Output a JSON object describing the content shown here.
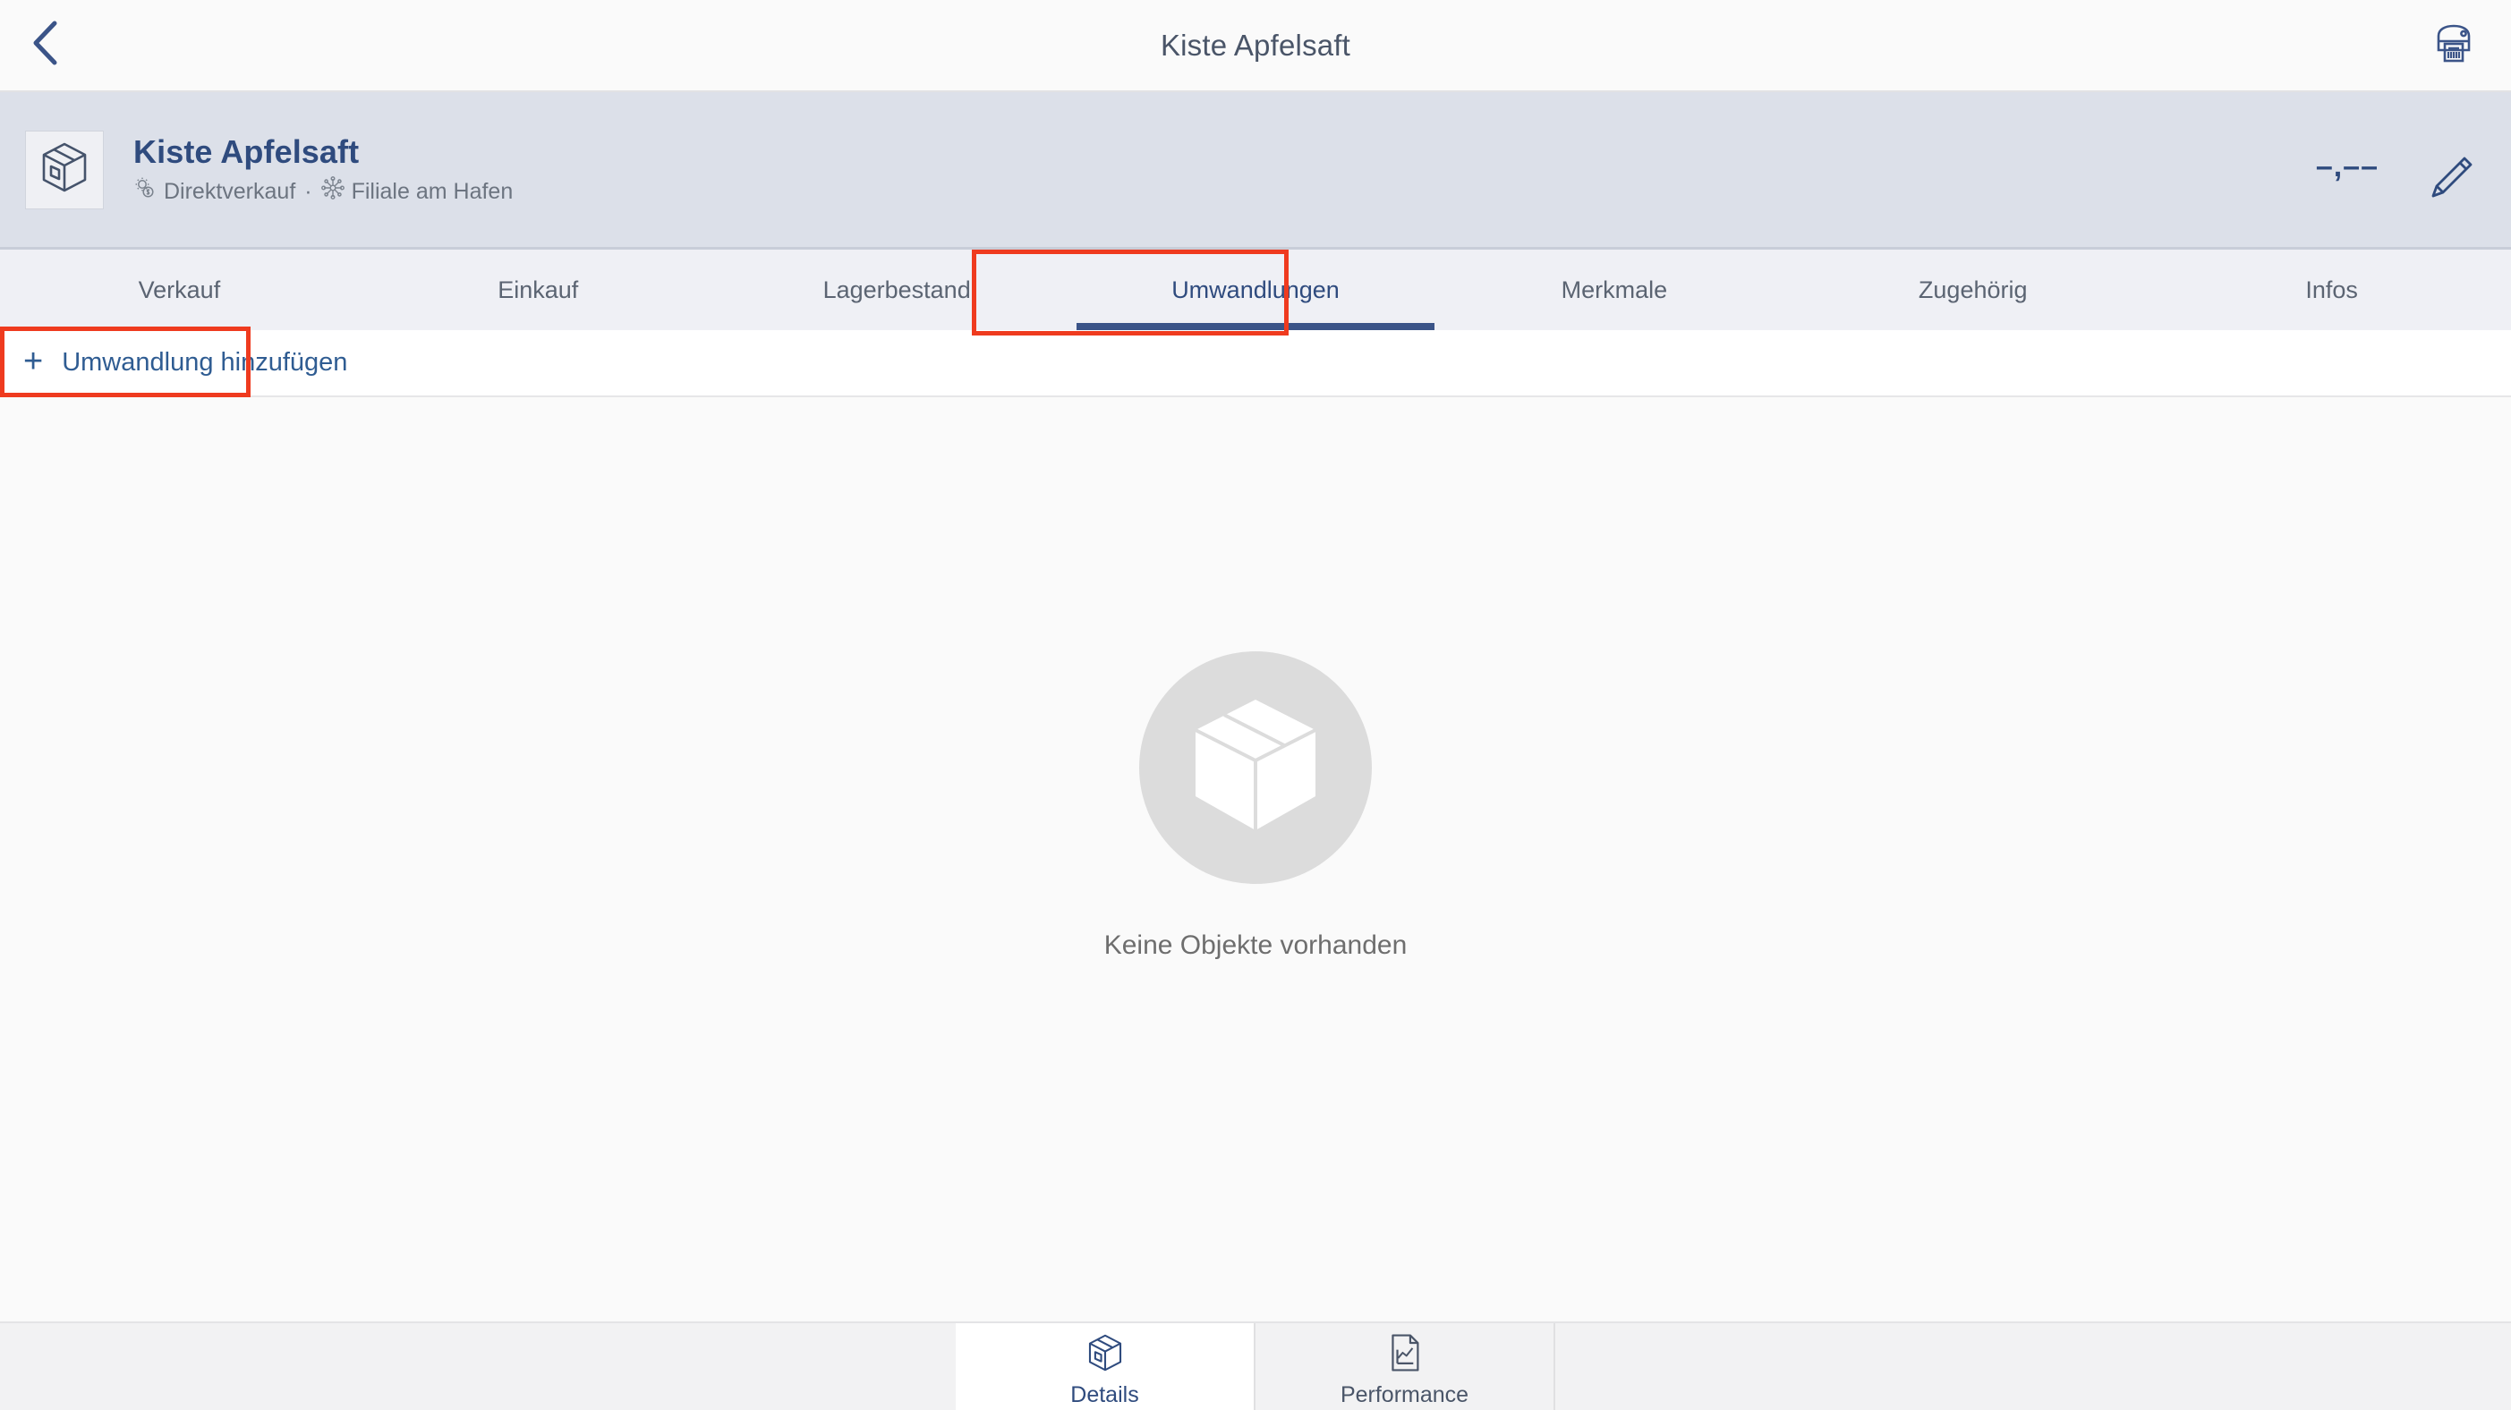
{
  "topbar": {
    "back_icon": "chevron-left-icon",
    "title": "Kiste Apfelsaft",
    "print_icon": "label-printer-icon"
  },
  "object_header": {
    "thumbnail_icon": "box-icon",
    "title": "Kiste Apfelsaft",
    "subtitle_icon_1": "price-gear-icon",
    "subtitle_part_1": "Direktverkauf",
    "separator": "·",
    "subtitle_icon_2": "network-hub-icon",
    "subtitle_part_2": "Filiale am Hafen",
    "price": "–,––",
    "edit_icon": "pencil-icon"
  },
  "tabs": [
    {
      "label": "Verkauf",
      "active": false
    },
    {
      "label": "Einkauf",
      "active": false
    },
    {
      "label": "Lagerbestand",
      "active": false
    },
    {
      "label": "Umwandlungen",
      "active": true
    },
    {
      "label": "Merkmale",
      "active": false
    },
    {
      "label": "Zugehörig",
      "active": false
    },
    {
      "label": "Infos",
      "active": false
    }
  ],
  "toolbar": {
    "add_icon": "plus-icon",
    "add_label": "Umwandlung hinzufügen"
  },
  "empty_state": {
    "icon": "box-3d-icon",
    "message": "Keine Objekte vorhanden"
  },
  "bottom_nav": [
    {
      "label": "Details",
      "icon": "box-icon",
      "active": true
    },
    {
      "label": "Performance",
      "icon": "chart-document-icon",
      "active": false
    }
  ],
  "colors": {
    "brand_blue": "#2f4b7e",
    "link_blue": "#2f5c92",
    "active_underline": "#3b5488",
    "annotation_red": "#ef3b1f",
    "header_band": "#dce0e9",
    "tabbar_bg": "#eff0f5",
    "content_bg": "#fafafa",
    "muted_text": "#6c7480"
  }
}
